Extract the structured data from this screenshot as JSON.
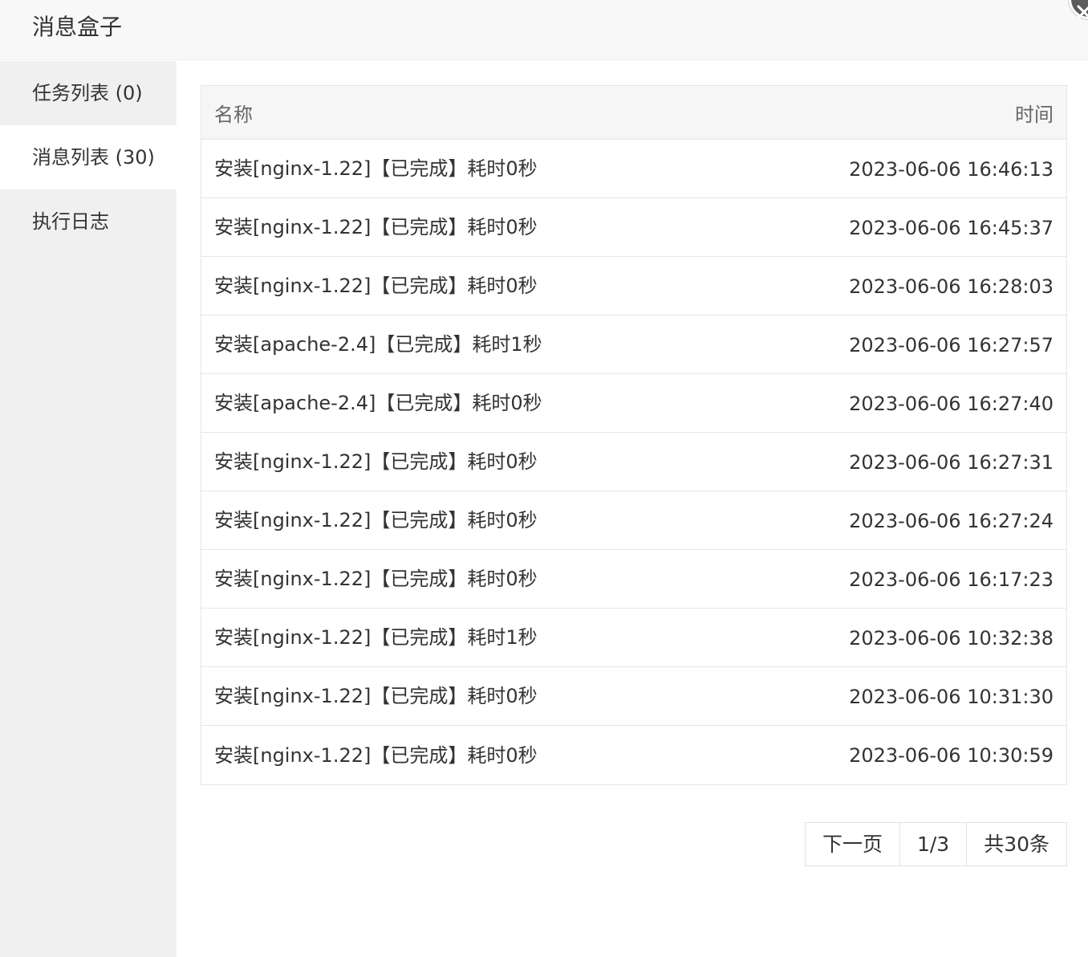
{
  "window": {
    "title": "消息盒子"
  },
  "sidebar": {
    "items": [
      {
        "label": "任务列表 (0)"
      },
      {
        "label": "消息列表 (30)"
      },
      {
        "label": "执行日志"
      }
    ]
  },
  "table": {
    "headers": {
      "name": "名称",
      "time": "时间"
    },
    "rows": [
      {
        "name": "安装[nginx-1.22]【已完成】耗时0秒",
        "time": "2023-06-06 16:46:13"
      },
      {
        "name": "安装[nginx-1.22]【已完成】耗时0秒",
        "time": "2023-06-06 16:45:37"
      },
      {
        "name": "安装[nginx-1.22]【已完成】耗时0秒",
        "time": "2023-06-06 16:28:03"
      },
      {
        "name": "安装[apache-2.4]【已完成】耗时1秒",
        "time": "2023-06-06 16:27:57"
      },
      {
        "name": "安装[apache-2.4]【已完成】耗时0秒",
        "time": "2023-06-06 16:27:40"
      },
      {
        "name": "安装[nginx-1.22]【已完成】耗时0秒",
        "time": "2023-06-06 16:27:31"
      },
      {
        "name": "安装[nginx-1.22]【已完成】耗时0秒",
        "time": "2023-06-06 16:27:24"
      },
      {
        "name": "安装[nginx-1.22]【已完成】耗时0秒",
        "time": "2023-06-06 16:17:23"
      },
      {
        "name": "安装[nginx-1.22]【已完成】耗时1秒",
        "time": "2023-06-06 10:32:38"
      },
      {
        "name": "安装[nginx-1.22]【已完成】耗时0秒",
        "time": "2023-06-06 10:31:30"
      },
      {
        "name": "安装[nginx-1.22]【已完成】耗时0秒",
        "time": "2023-06-06 10:30:59"
      }
    ]
  },
  "pager": {
    "next_label": "下一页",
    "page": "1/3",
    "total": "共30条"
  },
  "icons": {
    "close": "close-icon"
  }
}
